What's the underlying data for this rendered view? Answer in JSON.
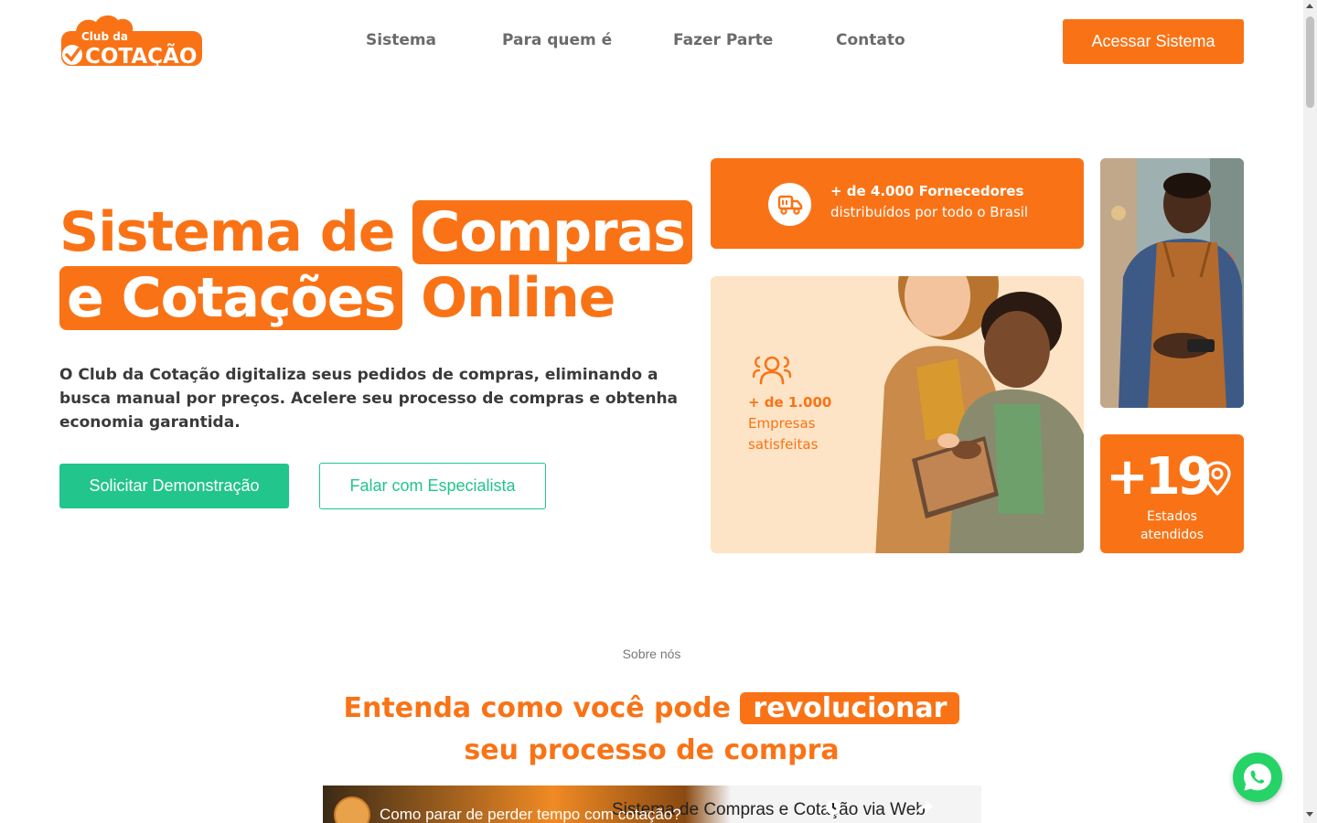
{
  "header": {
    "logo_text_top": "Club da",
    "logo_text_bottom": "COTAÇÃO",
    "nav": [
      "Sistema",
      "Para quem é",
      "Fazer Parte",
      "Contato"
    ],
    "cta": "Acessar Sistema"
  },
  "hero": {
    "title_part1": "Sistema de",
    "title_highlight1": "Compras",
    "title_highlight2": "e Cotações",
    "title_part2": "Online",
    "description": "O Club da Cotação digitaliza seus pedidos de compras, eliminando a busca manual por preços. Acelere seu processo de compras e obtenha economia garantida.",
    "btn_demo": "Solicitar Demonstração",
    "btn_specialist": "Falar com Especialista"
  },
  "stats": {
    "suppliers_title": "+ de 4.000 Fornecedores",
    "suppliers_sub": "distribuídos por todo o Brasil",
    "companies_count": "+ de 1.000",
    "companies_label1": "Empresas",
    "companies_label2": "satisfeitas",
    "states_number": "+19",
    "states_label1": "Estados",
    "states_label2": "atendidos"
  },
  "about": {
    "eyebrow": "Sobre nós",
    "title_before": "Entenda como você pode",
    "title_highlight": "revolucionar",
    "title_after": "seu processo de compra"
  },
  "video": {
    "title": "Como parar de perder tempo com cotação?",
    "overlay_title": "Sistema de Compras e Cotação via Web"
  },
  "colors": {
    "brand_orange": "#f97316",
    "brand_green": "#22c58b",
    "peach": "#fde4c6"
  }
}
